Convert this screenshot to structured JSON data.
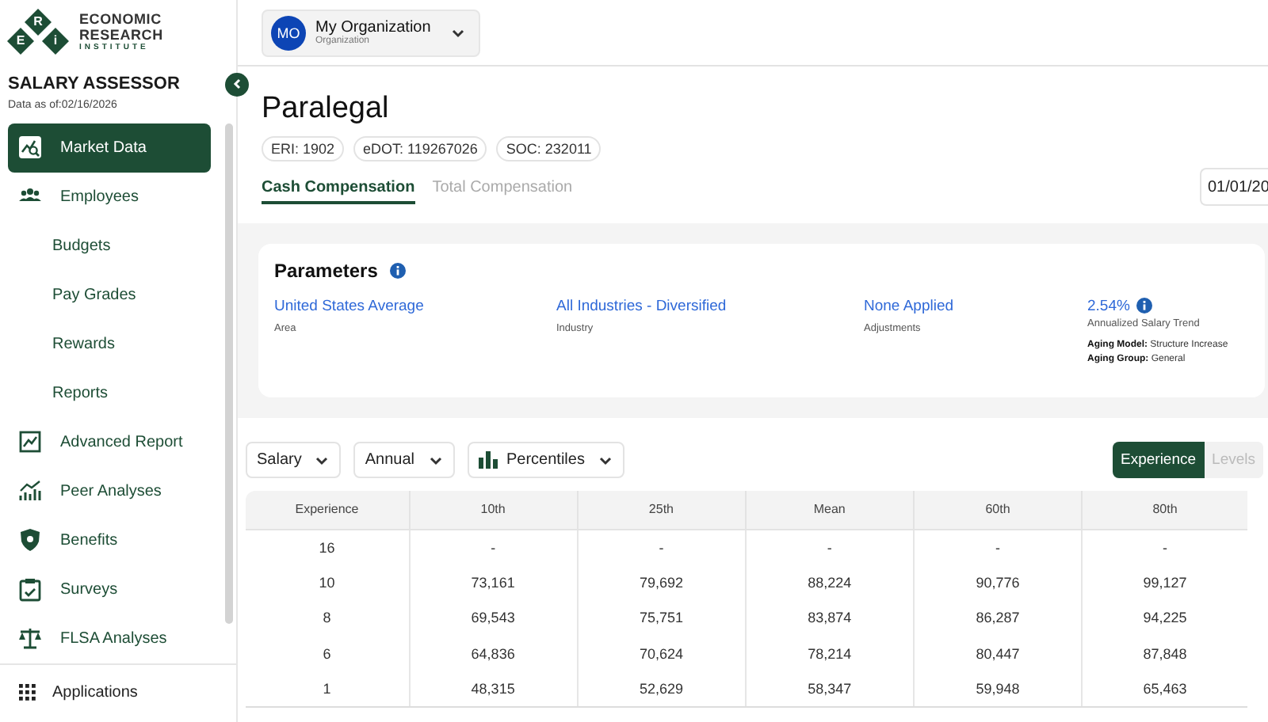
{
  "sidebar": {
    "logo": {
      "letters": [
        "E",
        "R",
        "i"
      ],
      "lines": [
        "ECONOMIC",
        "RESEARCH",
        "INSTITUTE"
      ]
    },
    "app_title": "SALARY ASSESSOR",
    "data_date": "Data as of:02/16/2026",
    "items": [
      {
        "label": "Market Data",
        "kind": "main",
        "selected": true
      },
      {
        "label": "Employees",
        "kind": "main",
        "selected": false
      },
      {
        "label": "Budgets",
        "kind": "sub",
        "selected": false
      },
      {
        "label": "Pay Grades",
        "kind": "sub",
        "selected": false
      },
      {
        "label": "Rewards",
        "kind": "sub",
        "selected": false
      },
      {
        "label": "Reports",
        "kind": "sub",
        "selected": false
      },
      {
        "label": "Advanced Report",
        "kind": "main",
        "selected": false
      },
      {
        "label": "Peer Analyses",
        "kind": "main",
        "selected": false
      },
      {
        "label": "Benefits",
        "kind": "main",
        "selected": false
      },
      {
        "label": "Surveys",
        "kind": "main",
        "selected": false
      },
      {
        "label": "FLSA Analyses",
        "kind": "main",
        "selected": false
      }
    ],
    "footer": "Applications"
  },
  "header": {
    "org": {
      "initials": "MO",
      "name": "My Organization",
      "type": "Organization"
    }
  },
  "job": {
    "title": "Paralegal",
    "codes": [
      "ERI: 1902",
      "eDOT: 119267026",
      "SOC: 232011"
    ],
    "tabs": [
      {
        "label": "Cash Compensation",
        "selected": true
      },
      {
        "label": "Total Compensation",
        "selected": false
      }
    ],
    "date": "01/01/20"
  },
  "parameters": {
    "title": "Parameters",
    "items": [
      {
        "value": "United States Average",
        "label": "Area"
      },
      {
        "value": "All Industries - Diversified",
        "label": "Industry"
      },
      {
        "value": "None Applied",
        "label": "Adjustments"
      },
      {
        "value": "2.54%",
        "label": "Annualized Salary Trend",
        "info": true,
        "notes": [
          "**Aging Model:** Structure Increase",
          "**Aging Group:** General"
        ]
      }
    ]
  },
  "filters": [
    {
      "label": "Salary",
      "kind": "plain"
    },
    {
      "label": "Annual",
      "kind": "plain"
    },
    {
      "label": "Percentiles",
      "kind": "chart"
    }
  ],
  "view_toggle": [
    {
      "label": "Experience",
      "selected": true
    },
    {
      "label": "Levels",
      "selected": false
    }
  ],
  "table": {
    "columns": [
      "Experience",
      "10th",
      "25th",
      "Mean",
      "60th",
      "80th"
    ],
    "rows": [
      [
        "16",
        "-",
        "-",
        "-",
        "-",
        "-"
      ],
      [
        "10",
        "73,161",
        "79,692",
        "88,224",
        "90,776",
        "99,127"
      ],
      [
        "8",
        "69,543",
        "75,751",
        "83,874",
        "86,287",
        "94,225"
      ],
      [
        "6",
        "64,836",
        "70,624",
        "78,214",
        "80,447",
        "87,848"
      ],
      [
        "1",
        "48,315",
        "52,629",
        "58,347",
        "59,948",
        "65,463"
      ]
    ]
  }
}
